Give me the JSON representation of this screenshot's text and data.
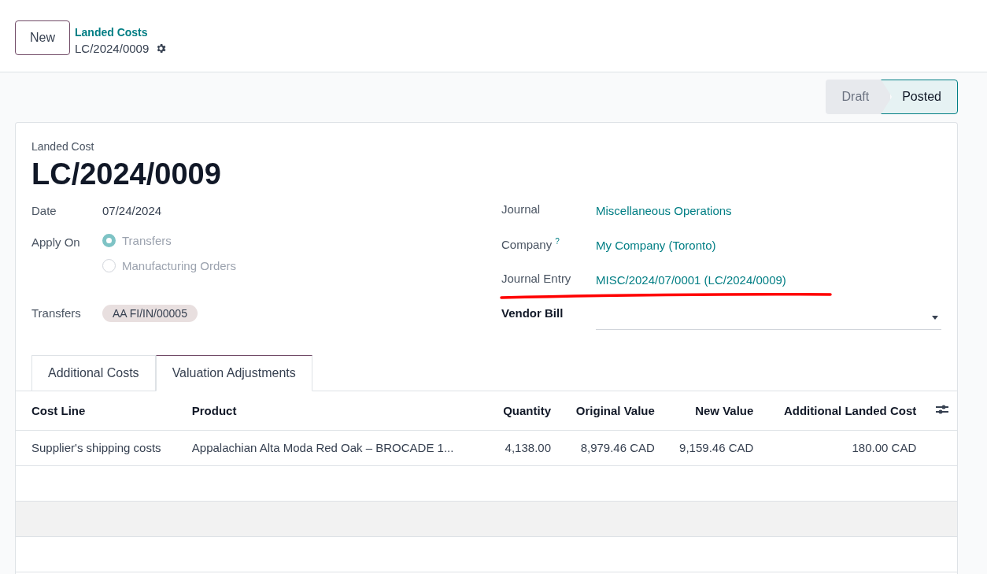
{
  "control_panel": {
    "new_button": "New",
    "breadcrumb": "Landed Costs",
    "record": "LC/2024/0009"
  },
  "statusbar": [
    {
      "label": "Draft",
      "selected": false
    },
    {
      "label": "Posted",
      "selected": true
    }
  ],
  "form": {
    "caption": "Landed Cost",
    "title": "LC/2024/0009",
    "left": [
      {
        "kind": "text",
        "label": "Date",
        "value": "07/24/2024"
      },
      {
        "kind": "radio",
        "label": "Apply On",
        "options": [
          {
            "label": "Transfers",
            "selected": true
          },
          {
            "label": "Manufacturing Orders",
            "selected": false
          }
        ]
      },
      {
        "kind": "tags",
        "label": "Transfers",
        "tags": [
          "AA FI/IN/00005"
        ]
      }
    ],
    "right": [
      {
        "kind": "link",
        "label": "Journal",
        "value": "Miscellaneous Operations",
        "underlined": false
      },
      {
        "kind": "link",
        "label": "Company",
        "help_mark": "?",
        "value": "My Company (Toronto)",
        "underlined": false
      },
      {
        "kind": "link",
        "label": "Journal Entry",
        "value": "MISC/2024/07/0001 (LC/2024/0009)",
        "underlined": true
      },
      {
        "kind": "select",
        "label": "Vendor Bill",
        "underlined": false
      }
    ]
  },
  "tabs": [
    {
      "label": "Additional Costs",
      "selected": false
    },
    {
      "label": "Valuation Adjustments",
      "selected": true
    }
  ],
  "table": {
    "columns": [
      "Cost Line",
      "Product",
      "Quantity",
      "Original Value",
      "New Value",
      "Additional Landed Cost"
    ],
    "rows": [
      [
        "Supplier's shipping costs",
        "Appalachian Alta Moda Red Oak – BROCADE 1...",
        "4,138.00",
        "8,979.46 CAD",
        "9,159.46 CAD",
        "180.00 CAD"
      ]
    ]
  }
}
